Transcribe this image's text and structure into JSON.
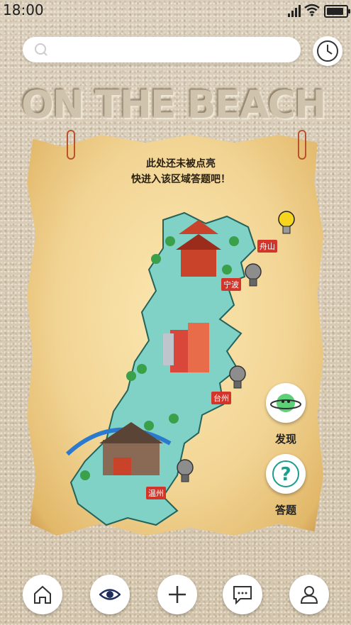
{
  "status_bar": {
    "time": "18:00",
    "battery_level": 0.9
  },
  "search": {
    "placeholder": ""
  },
  "banner": {
    "text": "ON THE BEACH"
  },
  "map": {
    "prompt_line1": "此处还未被点亮",
    "prompt_line2": "快进入该区域答题吧！",
    "cities": [
      {
        "name": "舟山",
        "lit": true
      },
      {
        "name": "宁波",
        "lit": false
      },
      {
        "name": "台州",
        "lit": false
      },
      {
        "name": "温州",
        "lit": false
      }
    ]
  },
  "side_actions": {
    "discover_label": "发现",
    "quiz_label": "答题"
  },
  "nav": {
    "items": [
      "home-icon",
      "eye-icon",
      "plus-icon",
      "chat-icon",
      "profile-icon"
    ]
  },
  "colors": {
    "accent_teal": "#1e9c8c",
    "city_tag": "#d3352a",
    "bulb_lit": "#f7d51e",
    "bulb_off": "#8d8d8d"
  }
}
